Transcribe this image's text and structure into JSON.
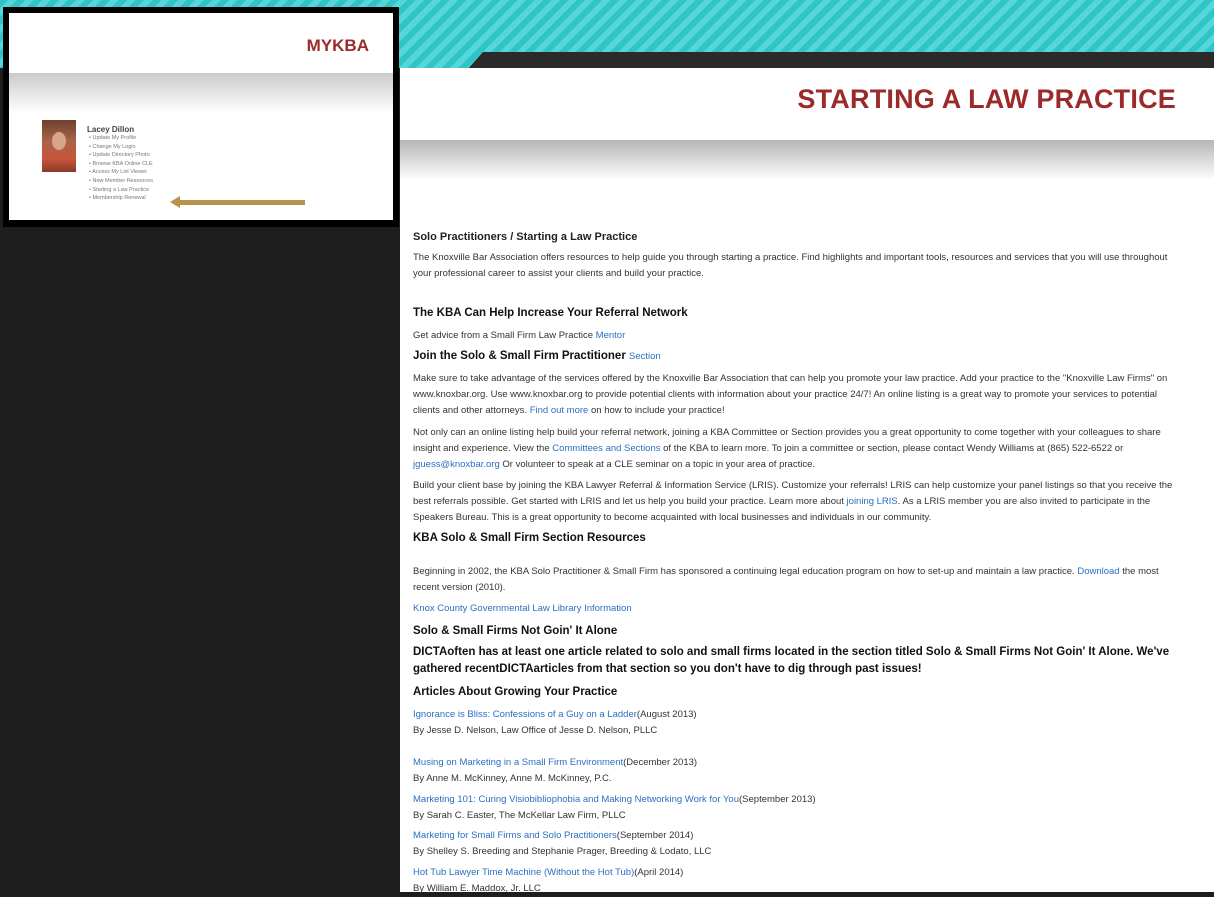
{
  "header": {
    "title": "STARTING A LAW PRACTICE"
  },
  "inset": {
    "brand": "MYKBA",
    "profile_name": "Lacey Dillon",
    "links": [
      "Update My Profile",
      "Change My Login",
      "Update Directory Photo",
      "Browse KBA Online CLE",
      "Access My List Viewer",
      "New Member Resources",
      "Starting a Law Practice",
      "Membership Renewal"
    ]
  },
  "content": {
    "section_title": "Solo Practitioners / Starting a Law Practice",
    "intro": "The Knoxville Bar Association offers resources to help guide you through starting a practice.  Find highlights and important tools, resources and services that you will use throughout your professional career to assist your clients and build your practice.",
    "referral_heading": "The KBA Can Help Increase Your Referral Network",
    "mentor_text": "Get advice from a Small Firm Law Practice ",
    "mentor_link": "Mentor",
    "join_heading": "Join the Solo & Small Firm Practitioner ",
    "join_link": "Section",
    "para1_a": "Make sure to take advantage of the services offered by the Knoxville Bar Association that can help you promote your law practice. Add your practice to the \"Knoxville Law Firms\" on www.knoxbar.org. Use www.knoxbar.org to provide potential clients with information about your practice 24/7! An online listing is a great way to promote your services to potential clients and other attorneys. ",
    "para1_link": "Find out more",
    "para1_b": " on how to include your practice!",
    "para2_a": "Not only can an online listing help build your referral network, joining a KBA Committee or Section provides you a great opportunity to come together with your colleagues to share insight and experience. View the ",
    "para2_link1": "Committees and Sections",
    "para2_b": " of the KBA to learn more. To join a committee or section, please contact Wendy Williams at (865) 522-6522 or ",
    "para2_link2": "jguess@knoxbar.org",
    "para2_c": "  Or volunteer to speak at a CLE seminar on a topic in your area of practice.",
    "para3_a": "Build your client base by joining the KBA Lawyer Referral & Information Service (LRIS).  Customize your referrals! LRIS can help customize your panel listings so that you receive the best referrals possible. Get started with LRIS and let us help you build your practice. Learn more about ",
    "para3_link": "joining LRIS",
    "para3_b": ".  As a LRIS member you are also invited to participate in the Speakers Bureau. This is a great opportunity to become acquainted with local businesses and individuals in our community.",
    "resources_heading": "KBA Solo & Small Firm Section Resources",
    "resources_a": "Beginning in 2002, the KBA Solo Practitioner & Small Firm has sponsored a continuing legal education program on how to set-up and maintain a law practice. ",
    "resources_link": "Download",
    "resources_b": " the most recent version (2010).",
    "library_link": "Knox County Governmental Law Library Information",
    "alone_heading": "Solo & Small Firms Not Goin' It Alone",
    "alone_text": "DICTAoften has at least one article related to solo and small firms located in the section titled Solo & Small Firms Not Goin' It Alone. We've gathered recentDICTAarticles from that section so you don't have to dig through past issues!",
    "articles_heading": "Articles About Growing Your Practice",
    "articles": [
      {
        "title": "Ignorance is Bliss: Confessions of a Guy on a Ladder",
        "date": "(August 2013)",
        "author": "By Jesse D. Nelson, Law Office of Jesse D. Nelson, PLLC"
      },
      {
        "title": "Musing on Marketing in a Small Firm Environment",
        "date": "(December 2013)",
        "author": "By Anne M. McKinney, Anne M. McKinney, P.C."
      },
      {
        "title": "Marketing 101: Curing Visiobibliophobia and Making Networking Work for You",
        "date": "(September 2013)",
        "author": "By Sarah C. Easter, The McKellar Law Firm, PLLC"
      },
      {
        "title": "Marketing for Small Firms and Solo Practitioners",
        "date": "(September 2014)",
        "author": "By Shelley S. Breeding and Stephanie Prager, Breeding & Lodato, LLC"
      },
      {
        "title": "Hot Tub Lawyer Time Machine (Without the Hot Tub)",
        "date": "(April 2014)",
        "author": "By William E. Maddox, Jr. LLC"
      }
    ]
  }
}
